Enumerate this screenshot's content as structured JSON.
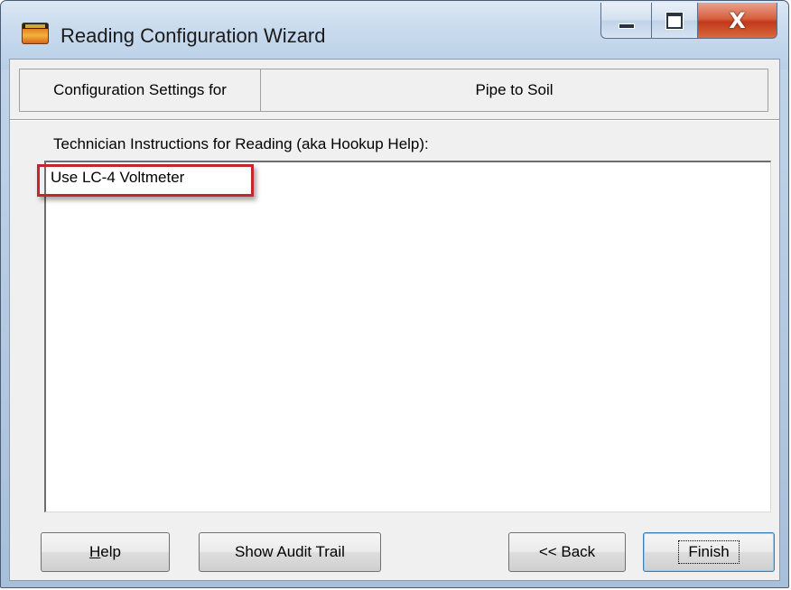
{
  "window": {
    "title": "Reading Configuration Wizard",
    "app_icon": "app-logo-icon"
  },
  "title_buttons": {
    "minimize_icon": "minimize-icon",
    "maximize_icon": "maximize-icon",
    "close_icon": "close-icon",
    "close_glyph": "X"
  },
  "header": {
    "config_label": "Configuration Settings for",
    "config_value": "Pipe to Soil"
  },
  "instructions": {
    "label": "Technician Instructions for Reading (aka Hookup Help):",
    "text": "Use LC-4 Voltmeter"
  },
  "buttons": {
    "help_prefix": "",
    "help_mnemonic": "H",
    "help_rest": "elp",
    "audit": "Show Audit Trail",
    "back": "<< Back",
    "finish": "Finish"
  },
  "colors": {
    "highlight": "#c1272d",
    "close_button": "#c2391b",
    "title_bar": "#c9dbee",
    "dialog_bg": "#f0f0f0"
  }
}
